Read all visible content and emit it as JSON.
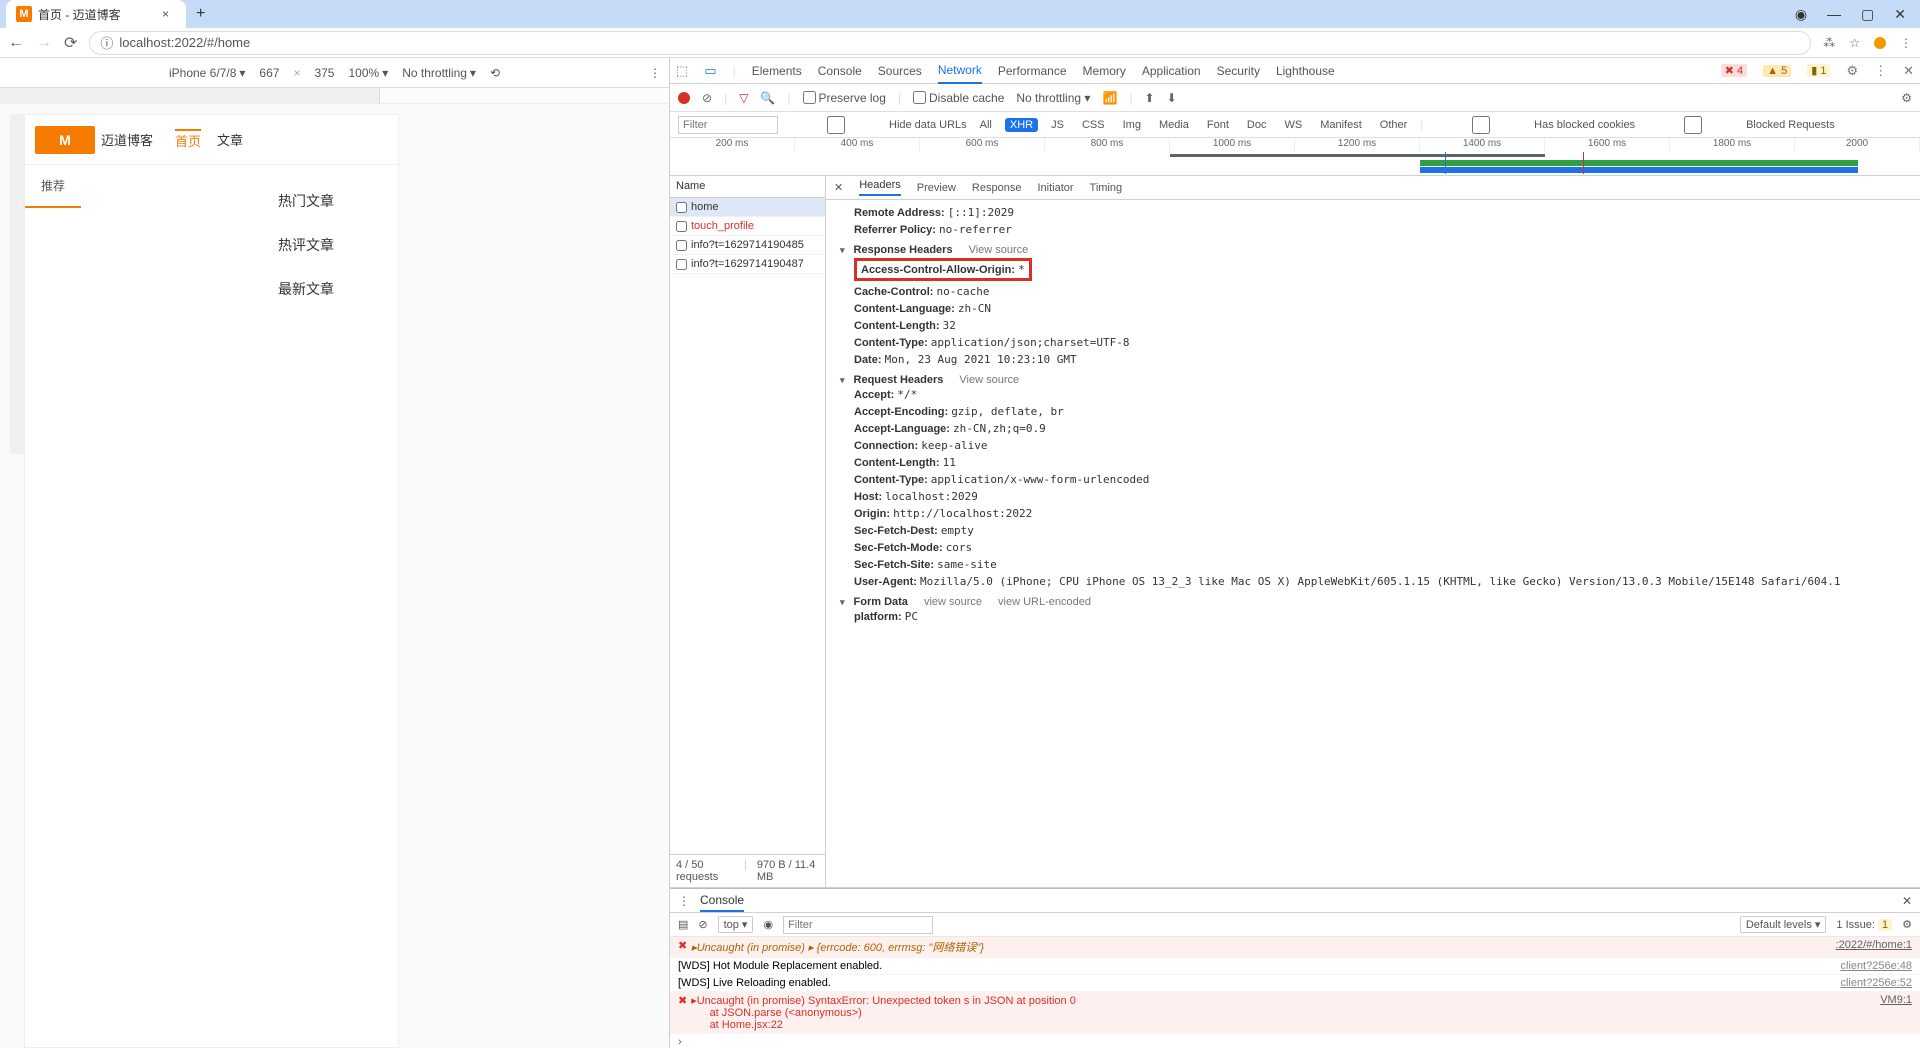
{
  "browser": {
    "tab_title": "首页 - 迈道博客",
    "url": "localhost:2022/#/home",
    "window_controls": {
      "min": "—",
      "max": "▢",
      "close": "✕",
      "disc": "◉"
    }
  },
  "device_toolbar": {
    "device": "iPhone 6/7/8",
    "width": "667",
    "height": "375",
    "zoom": "100%",
    "throttle": "No throttling"
  },
  "page_content": {
    "logo_text": "迈道博客",
    "nav_home": "首页",
    "nav_articles": "文章",
    "side_tag": "推荐",
    "hot_articles": "热门文章",
    "hot_comments": "热评文章",
    "latest_articles": "最新文章"
  },
  "devtools": {
    "tabs": [
      "Elements",
      "Console",
      "Sources",
      "Network",
      "Performance",
      "Memory",
      "Application",
      "Security",
      "Lighthouse"
    ],
    "active_tab": "Network",
    "errors": "4",
    "warnings": "5",
    "issues": "1",
    "toolbar": {
      "preserve_log": "Preserve log",
      "disable_cache": "Disable cache",
      "throttling": "No throttling"
    },
    "filter": {
      "placeholder": "Filter",
      "hide_data": "Hide data URLs",
      "types": [
        "All",
        "XHR",
        "JS",
        "CSS",
        "Img",
        "Media",
        "Font",
        "Doc",
        "WS",
        "Manifest",
        "Other"
      ],
      "active": "XHR",
      "blocked_cookies": "Has blocked cookies",
      "blocked_requests": "Blocked Requests"
    },
    "timeline_ticks": [
      "200 ms",
      "400 ms",
      "600 ms",
      "800 ms",
      "1000 ms",
      "1200 ms",
      "1400 ms",
      "1600 ms",
      "1800 ms",
      "2000"
    ],
    "requests": {
      "header": "Name",
      "items": [
        {
          "name": "home",
          "selected": true,
          "err": false
        },
        {
          "name": "touch_profile",
          "selected": false,
          "err": true
        },
        {
          "name": "info?t=1629714190485",
          "selected": false,
          "err": false
        },
        {
          "name": "info?t=1629714190487",
          "selected": false,
          "err": false
        }
      ],
      "footer_count": "4 / 50 requests",
      "footer_size": "970 B / 11.4 MB"
    },
    "detail": {
      "tabs": [
        "Headers",
        "Preview",
        "Response",
        "Initiator",
        "Timing"
      ],
      "active": "Headers",
      "general": [
        {
          "k": "Remote Address:",
          "v": "[::1]:2029"
        },
        {
          "k": "Referrer Policy:",
          "v": "no-referrer"
        }
      ],
      "response_headers_title": "Response Headers",
      "view_source": "View source",
      "highlighted": {
        "k": "Access-Control-Allow-Origin:",
        "v": "*"
      },
      "response_headers": [
        {
          "k": "Cache-Control:",
          "v": "no-cache"
        },
        {
          "k": "Content-Language:",
          "v": "zh-CN"
        },
        {
          "k": "Content-Length:",
          "v": "32"
        },
        {
          "k": "Content-Type:",
          "v": "application/json;charset=UTF-8"
        },
        {
          "k": "Date:",
          "v": "Mon, 23 Aug 2021 10:23:10 GMT"
        }
      ],
      "request_headers_title": "Request Headers",
      "request_headers": [
        {
          "k": "Accept:",
          "v": "*/*"
        },
        {
          "k": "Accept-Encoding:",
          "v": "gzip, deflate, br"
        },
        {
          "k": "Accept-Language:",
          "v": "zh-CN,zh;q=0.9"
        },
        {
          "k": "Connection:",
          "v": "keep-alive"
        },
        {
          "k": "Content-Length:",
          "v": "11"
        },
        {
          "k": "Content-Type:",
          "v": "application/x-www-form-urlencoded"
        },
        {
          "k": "Host:",
          "v": "localhost:2029"
        },
        {
          "k": "Origin:",
          "v": "http://localhost:2022"
        },
        {
          "k": "Sec-Fetch-Dest:",
          "v": "empty"
        },
        {
          "k": "Sec-Fetch-Mode:",
          "v": "cors"
        },
        {
          "k": "Sec-Fetch-Site:",
          "v": "same-site"
        },
        {
          "k": "User-Agent:",
          "v": "Mozilla/5.0 (iPhone; CPU iPhone OS 13_2_3 like Mac OS X) AppleWebKit/605.1.15 (KHTML, like Gecko) Version/13.0.3 Mobile/15E148 Safari/604.1"
        }
      ],
      "form_data_title": "Form Data",
      "view_source2": "view source",
      "view_url": "view URL-encoded",
      "form_data": [
        {
          "k": "platform:",
          "v": "PC"
        }
      ]
    }
  },
  "console_drawer": {
    "tab": "Console",
    "context": "top",
    "filter_placeholder": "Filter",
    "levels": "Default levels",
    "issues_label": "1 Issue:",
    "issues_badge": "1",
    "lines": [
      {
        "type": "err",
        "msg": "▸Uncaught (in promise) ▸ {errcode: 600, errmsg: \"网络错误\"}",
        "src": ":2022/#/home:1",
        "style": "warn"
      },
      {
        "type": "log",
        "msg": "[WDS] Hot Module Replacement enabled.",
        "src": "client?256e:48"
      },
      {
        "type": "log",
        "msg": "[WDS] Live Reloading enabled.",
        "src": "client?256e:52"
      },
      {
        "type": "err",
        "msg": "▸Uncaught (in promise) SyntaxError: Unexpected token s in JSON at position 0\n      at JSON.parse (<anonymous>)\n      at Home.jsx:22",
        "src": "VM9:1"
      }
    ]
  }
}
